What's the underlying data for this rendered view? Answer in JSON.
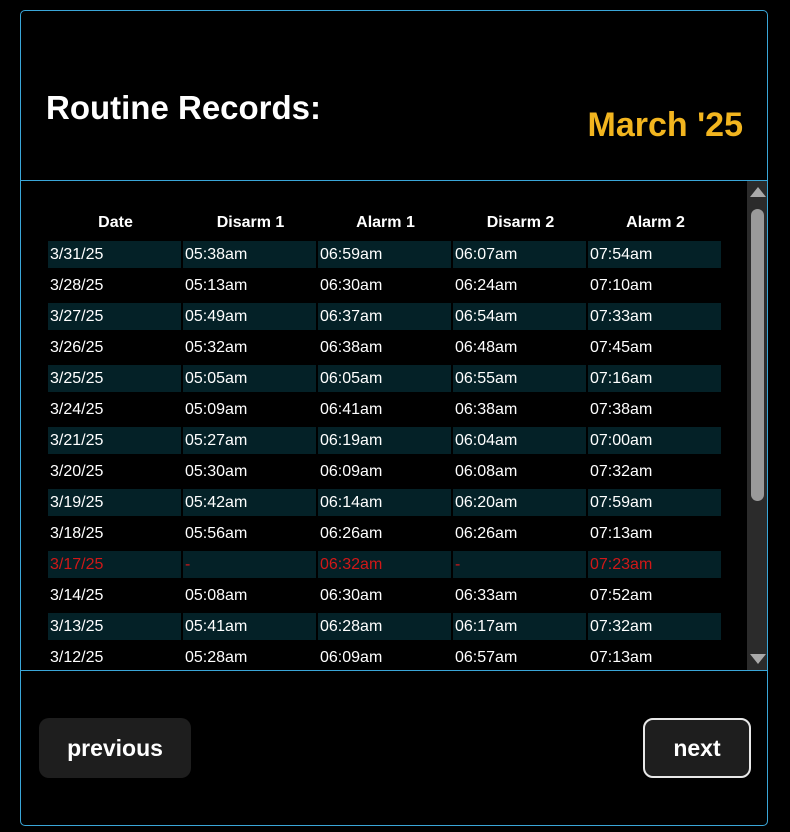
{
  "header": {
    "title": "Routine Records:",
    "month": "March '25"
  },
  "colors": {
    "accent": "#f2b51f",
    "border": "#3aa6d8",
    "row_shade": "#042127",
    "missed": "#d01818"
  },
  "table": {
    "columns": [
      "Date",
      "Disarm 1",
      "Alarm 1",
      "Disarm 2",
      "Alarm 2"
    ],
    "rows": [
      [
        "3/31/25",
        "05:38am",
        "06:59am",
        "06:07am",
        "07:54am"
      ],
      [
        "3/28/25",
        "05:13am",
        "06:30am",
        "06:24am",
        "07:10am"
      ],
      [
        "3/27/25",
        "05:49am",
        "06:37am",
        "06:54am",
        "07:33am"
      ],
      [
        "3/26/25",
        "05:32am",
        "06:38am",
        "06:48am",
        "07:45am"
      ],
      [
        "3/25/25",
        "05:05am",
        "06:05am",
        "06:55am",
        "07:16am"
      ],
      [
        "3/24/25",
        "05:09am",
        "06:41am",
        "06:38am",
        "07:38am"
      ],
      [
        "3/21/25",
        "05:27am",
        "06:19am",
        "06:04am",
        "07:00am"
      ],
      [
        "3/20/25",
        "05:30am",
        "06:09am",
        "06:08am",
        "07:32am"
      ],
      [
        "3/19/25",
        "05:42am",
        "06:14am",
        "06:20am",
        "07:59am"
      ],
      [
        "3/18/25",
        "05:56am",
        "06:26am",
        "06:26am",
        "07:13am"
      ],
      [
        "3/17/25",
        "-",
        "06:32am",
        "-",
        "07:23am"
      ],
      [
        "3/14/25",
        "05:08am",
        "06:30am",
        "06:33am",
        "07:52am"
      ],
      [
        "3/13/25",
        "05:41am",
        "06:28am",
        "06:17am",
        "07:32am"
      ],
      [
        "3/12/25",
        "05:28am",
        "06:09am",
        "06:57am",
        "07:13am"
      ]
    ],
    "missed_rows": [
      10
    ]
  },
  "buttons": {
    "previous": "previous",
    "next": "next"
  }
}
